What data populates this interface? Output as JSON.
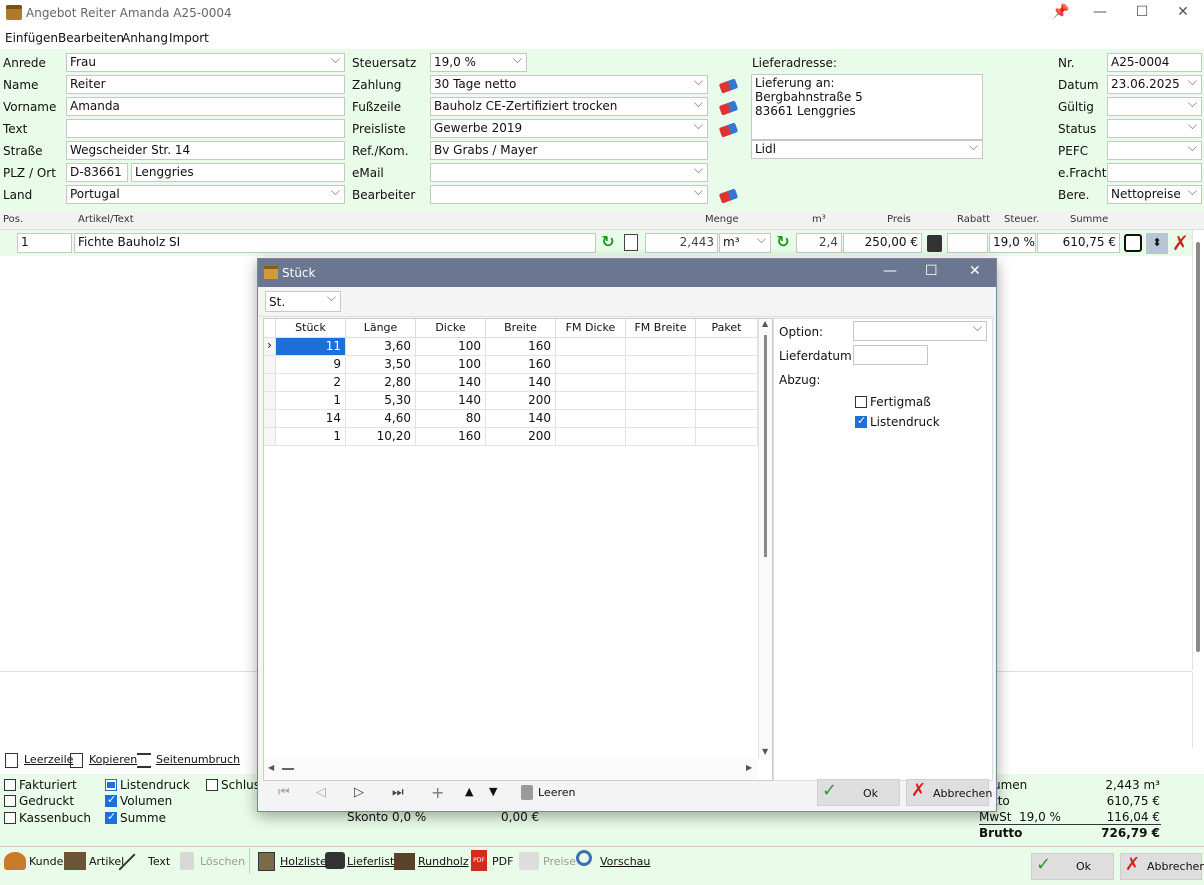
{
  "window": {
    "title": "Angebot Reiter Amanda A25-0004"
  },
  "menu": [
    "Einfügen",
    "Bearbeiten",
    "Anhang",
    "Import"
  ],
  "customer": {
    "labels": [
      "Anrede",
      "Name",
      "Vorname",
      "Text",
      "Straße",
      "PLZ / Ort",
      "Land"
    ],
    "anrede": "Frau",
    "name": "Reiter",
    "vorname": "Amanda",
    "text": "",
    "strasse": "Wegscheider Str. 14",
    "plz": "D-83661",
    "ort": "Lenggries",
    "land": "Portugal"
  },
  "terms": {
    "labels": [
      "Steuersatz",
      "Zahlung",
      "Fußzeile",
      "Preisliste",
      "Ref./Kom.",
      "eMail",
      "Bearbeiter"
    ],
    "steuersatz": "19,0 %",
    "zahlung": "30 Tage netto",
    "fusszeile": "Bauholz CE-Zertifiziert trocken",
    "preisliste": "Gewerbe 2019",
    "ref": "Bv Grabs / Mayer",
    "email": "",
    "bearbeiter": ""
  },
  "delivery": {
    "label": "Lieferadresse:",
    "lines": [
      "Lieferung an:",
      "Bergbahnstraße 5",
      "83661 Lenggries"
    ],
    "carrier": "Lidl"
  },
  "meta": {
    "labels": [
      "Nr.",
      "Datum",
      "Gültig",
      "Status",
      "PEFC",
      "e.Fracht",
      "Bere."
    ],
    "nr": "A25-0004",
    "datum": "23.06.2025",
    "bere": "Nettopreise"
  },
  "grid": {
    "headers": {
      "pos": "Pos.",
      "artikel": "Artikel/Text",
      "menge": "Menge",
      "m3": "m³",
      "preis": "Preis",
      "rabatt": "Rabatt",
      "steuer": "Steuer.",
      "summe": "Summe"
    },
    "row": {
      "pos": "1",
      "artikel": "Fichte Bauholz SI",
      "menge": "2,443",
      "einheit": "m³",
      "m3": "2,4",
      "preis": "250,00 €",
      "rabatt": "",
      "steuer": "19,0 %",
      "summe": "610,75 €"
    }
  },
  "actions": {
    "leerzeile": "Leerzeile",
    "kopieren": "Kopieren",
    "seitenumbruch": "Seitenumbruch"
  },
  "flags": {
    "fakturiert": "Fakturiert",
    "gedruckt": "Gedruckt",
    "kassenbuch": "Kassenbuch",
    "listendruck": "Listendruck",
    "volumen": "Volumen",
    "summe": "Summe",
    "schluss": "Schluss"
  },
  "skonto": {
    "label": "Skonto",
    "pct": "0,0 %",
    "amount": "0,00 €"
  },
  "totals": {
    "volumen_label": "umen",
    "volumen": "2,443 m³",
    "netto_label": "tto",
    "netto": "610,75 €",
    "mwst_label": "MwSt",
    "mwst_pct": "19,0 %",
    "mwst": "116,04 €",
    "brutto_label": "Brutto",
    "brutto": "726,79 €"
  },
  "toolbar": [
    "Kunde",
    "Artikel",
    "Text",
    "Löschen",
    "Holzliste",
    "Lieferliste",
    "Rundholz",
    "PDF",
    "Preise",
    "Vorschau"
  ],
  "main_buttons": {
    "ok": "Ok",
    "cancel": "Abbrechen"
  },
  "dialog": {
    "title": "Stück",
    "unit": "St.",
    "columns": [
      "Stück",
      "Länge",
      "Dicke",
      "Breite",
      "FM Dicke",
      "FM Breite",
      "Paket"
    ],
    "rows": [
      [
        "11",
        "3,60",
        "100",
        "160",
        "",
        "",
        ""
      ],
      [
        "9",
        "3,50",
        "100",
        "160",
        "",
        "",
        ""
      ],
      [
        "2",
        "2,80",
        "140",
        "140",
        "",
        "",
        ""
      ],
      [
        "1",
        "5,30",
        "140",
        "200",
        "",
        "",
        ""
      ],
      [
        "14",
        "4,60",
        "80",
        "140",
        "",
        "",
        ""
      ],
      [
        "1",
        "10,20",
        "160",
        "200",
        "",
        "",
        ""
      ]
    ],
    "option_label": "Option:",
    "lieferdatum_label": "Lieferdatum:",
    "abzug_label": "Abzug:",
    "fertigmass": "Fertigmaß",
    "listendruck": "Listendruck",
    "leeren": "Leeren",
    "ok": "Ok",
    "cancel": "Abbrechen"
  }
}
